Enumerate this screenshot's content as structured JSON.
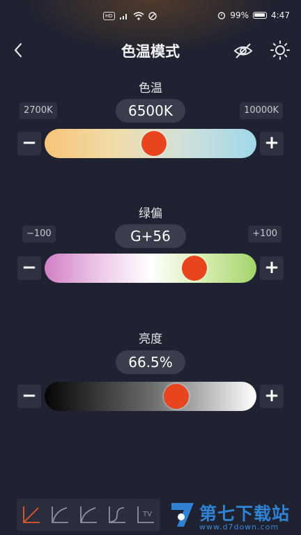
{
  "status_bar": {
    "battery_percent": "99%",
    "time": "4:47",
    "hd_badge": "HD"
  },
  "header": {
    "title": "色温模式"
  },
  "sections": [
    {
      "label": "色温",
      "min": "2700K",
      "max": "10000K",
      "value": "6500K",
      "position": 0.52,
      "gradient": [
        "#f6c576",
        "#f0dcaa",
        "#cfe0da",
        "#9fd8ea"
      ]
    },
    {
      "label": "绿偏",
      "min": "−100",
      "max": "+100",
      "value": "G+56",
      "position": 0.74,
      "gradient": [
        "#d180c4",
        "#ecc6e6",
        "#ffffff",
        "#d6eeb0",
        "#a3d36a"
      ]
    },
    {
      "label": "亮度",
      "min": "",
      "max": "",
      "value": "66.5%",
      "position": 0.64,
      "gradient": [
        "#050505",
        "#6a6a6a",
        "#ffffff"
      ]
    }
  ],
  "controls": {
    "minus": "−",
    "plus": "+"
  },
  "curves": {
    "tv_label": "TV",
    "active_color": "#e8572a",
    "inactive_color": "#8c90a0"
  },
  "brand": {
    "name": "第七下载站",
    "url": "www.d7down.com",
    "color": "#2f82d4"
  }
}
